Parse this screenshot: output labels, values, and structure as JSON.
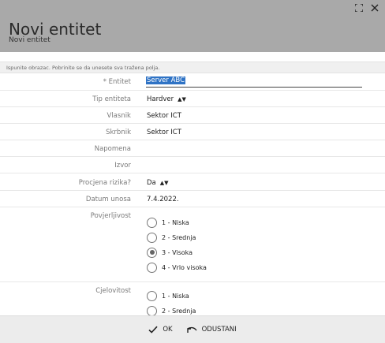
{
  "header": {
    "title": "Novi entitet",
    "subtitle": "Novi entitet",
    "icons": [
      "expand-icon",
      "close-icon"
    ]
  },
  "info_text": "Ispunite obrazac. Pobrinite se da unesete sva tražena polja.",
  "fields": {
    "entitet": {
      "label": "* Entitet",
      "value": "Server ABC"
    },
    "tip": {
      "label": "Tip entiteta",
      "value": "Hardver"
    },
    "vlasnik": {
      "label": "Vlasnik",
      "value": "Sektor ICT"
    },
    "skrbnik": {
      "label": "Skrbnik",
      "value": "Sektor ICT"
    },
    "napomena": {
      "label": "Napomena",
      "value": ""
    },
    "izvor": {
      "label": "Izvor",
      "value": ""
    },
    "procjena": {
      "label": "Procjena rizika?",
      "value": "Da"
    },
    "datum": {
      "label": "Datum unosa",
      "value": "7.4.2022."
    }
  },
  "povjerljivost": {
    "label": "Povjerljivost",
    "options": [
      "1 - Niska",
      "2 - Srednja",
      "3 - Visoka",
      "4 - Vrlo visoka"
    ],
    "selected": "3 - Visoka"
  },
  "cjelovitost": {
    "label": "Cjelovitost",
    "options": [
      "1 - Niska",
      "2 - Srednja"
    ]
  },
  "footer": {
    "ok_label": "OK",
    "cancel_label": "ODUSTANI"
  },
  "colors": {
    "header_bg": "#a9a9a9",
    "selection": "#2f73c5",
    "footer_bg": "#ececec"
  }
}
